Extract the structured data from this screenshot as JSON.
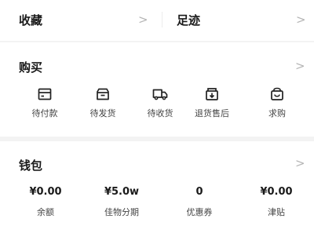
{
  "top_row": {
    "favorites_label": "收藏",
    "footprint_label": "足迹",
    "chevron": ">"
  },
  "purchase": {
    "title": "购买",
    "chevron": ">",
    "items": [
      {
        "label": "待付款",
        "icon": "wallet-card-icon"
      },
      {
        "label": "待发货",
        "icon": "package-icon"
      },
      {
        "label": "待收货",
        "icon": "delivery-truck-icon"
      },
      {
        "label": "退货售后",
        "icon": "return-icon"
      },
      {
        "label": "求购",
        "icon": "shopping-bag-icon"
      }
    ]
  },
  "wallet": {
    "title": "钱包",
    "chevron": ">",
    "items": [
      {
        "value": "¥0.00",
        "label": "余额"
      },
      {
        "value": "¥5.0w",
        "label": "佳物分期"
      },
      {
        "value": "0",
        "label": "优惠券"
      },
      {
        "value": "¥0.00",
        "label": "津贴"
      }
    ]
  },
  "colors": {
    "background": "#f3f3f3",
    "card": "#ffffff",
    "text_primary": "#1a1a1a",
    "text_secondary": "#444444",
    "chevron": "#b5b5b5"
  }
}
